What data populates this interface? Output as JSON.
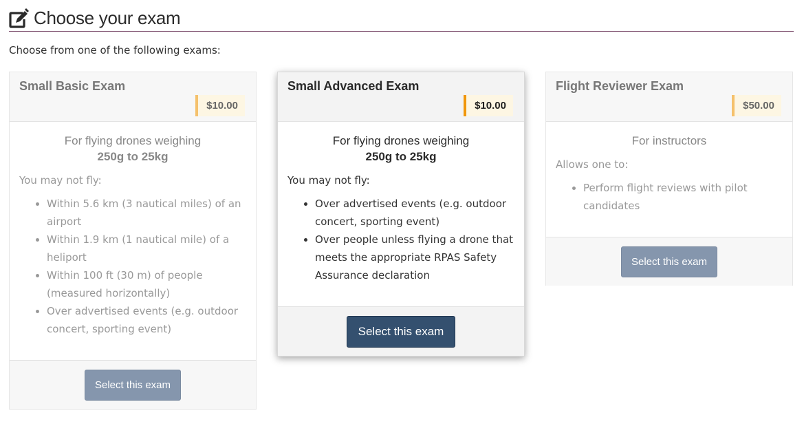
{
  "header": {
    "icon": "edit-icon",
    "title": "Choose your exam"
  },
  "intro": "Choose from one of the following exams:",
  "colors": {
    "accent_line": "#7a4a6a",
    "price_bar_muted": "#f5c16c",
    "price_bar_active": "#f0960a",
    "button_muted": "#8596ad",
    "button_active": "#34506f"
  },
  "exams": [
    {
      "title": "Small Basic Exam",
      "price": "$10.00",
      "lead_line1": "For flying drones weighing",
      "lead_line2": "250g to 25kg",
      "sub": "You may not fly:",
      "items": [
        "Within 5.6 km (3 nautical miles) of an airport",
        "Within 1.9 km (1 nautical mile) of a heliport",
        "Within 100 ft (30 m) of people (measured horizontally)",
        "Over advertised events (e.g. outdoor concert, sporting event)"
      ],
      "button": "Select this exam",
      "state": "muted"
    },
    {
      "title": "Small Advanced Exam",
      "price": "$10.00",
      "lead_line1": "For flying drones weighing",
      "lead_line2": "250g to 25kg",
      "sub": "You may not fly:",
      "items": [
        "Over advertised events (e.g. outdoor concert, sporting event)",
        "Over people unless flying a drone that meets the appropriate RPAS Safety Assurance declaration"
      ],
      "button": "Select this exam",
      "state": "active"
    },
    {
      "title": "Flight Reviewer Exam",
      "price": "$50.00",
      "lead_line1": "For instructors",
      "sub": "Allows one to:",
      "items": [
        "Perform flight reviews with pilot candidates"
      ],
      "button": "Select this exam",
      "state": "muted"
    }
  ]
}
